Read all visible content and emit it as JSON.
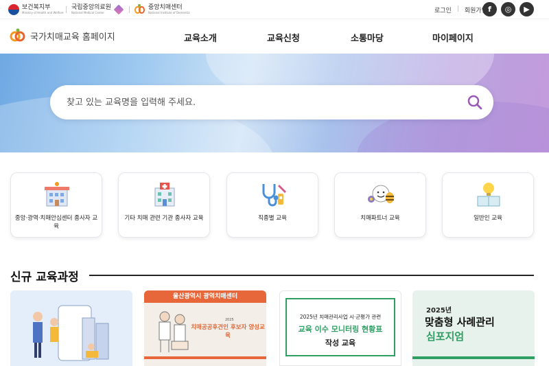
{
  "top": {
    "orgs": [
      {
        "name": "보건복지부",
        "sub": "Ministry of Health and Welfare"
      },
      {
        "name": "국립중앙의료원",
        "sub": "National Medical Center"
      },
      {
        "name": "중앙치매센터",
        "sub": "National Institute of Dementia"
      }
    ],
    "login": "로그인",
    "signup": "회원가입",
    "social": {
      "facebook": "f",
      "instagram": "◎",
      "youtube": "▶"
    }
  },
  "header": {
    "site_title": "국가치매교육 홈페이지",
    "nav": [
      "교육소개",
      "교육신청",
      "소통마당",
      "마이페이지"
    ]
  },
  "hero": {
    "search_placeholder": "찾고 있는 교육명을 입력해 주세요."
  },
  "categories": [
    {
      "label": "중앙·광역·치매안심센터 종사자 교육",
      "icon": "building-icon"
    },
    {
      "label": "기타 치매 관련 기관 종사자 교육",
      "icon": "hospital-icon"
    },
    {
      "label": "직종별 교육",
      "icon": "stethoscope-icon"
    },
    {
      "label": "치매파트너 교육",
      "icon": "bee-partner-icon"
    },
    {
      "label": "일반인 교육",
      "icon": "lightbulb-book-icon"
    }
  ],
  "section": {
    "title": "신규 교육과정"
  },
  "courses": [
    {
      "kind": "illustration"
    },
    {
      "band": "울산광역시 광역치매센터",
      "year": "2025",
      "title": "치매공공후견인 후보자 양성교육"
    },
    {
      "line1": "2025년 치매관리사업 시·군평가 관련",
      "line2": "교육 이수 모니터링 현황표",
      "line3": "작성 교육"
    },
    {
      "year": "2025년",
      "title1": "맞춤형 사례관리",
      "title2": "심포지엄"
    }
  ],
  "colors": {
    "accent_orange": "#e8673a",
    "accent_green": "#2f9e63",
    "search_icon": "#9b59b6"
  }
}
